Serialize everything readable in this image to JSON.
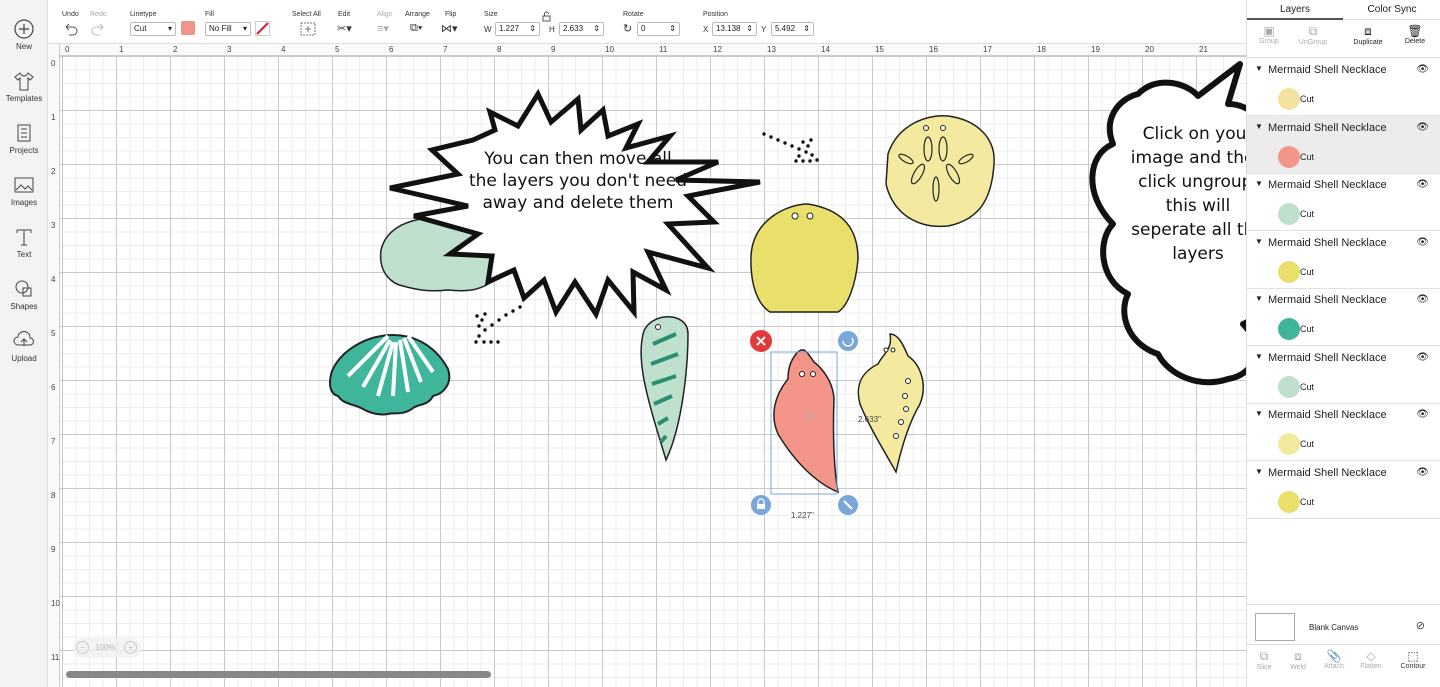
{
  "sidebar": {
    "items": [
      {
        "label": "New",
        "icon": "plus-circle-icon"
      },
      {
        "label": "Templates",
        "icon": "shirt-icon"
      },
      {
        "label": "Projects",
        "icon": "projects-icon"
      },
      {
        "label": "Images",
        "icon": "image-icon"
      },
      {
        "label": "Text",
        "icon": "text-icon"
      },
      {
        "label": "Shapes",
        "icon": "shapes-icon"
      },
      {
        "label": "Upload",
        "icon": "upload-icon"
      }
    ]
  },
  "toolbar": {
    "undo": "Undo",
    "redo": "Redo",
    "linetype_label": "Linetype",
    "linetype_value": "Cut",
    "fill_label": "Fill",
    "fill_value": "No Fill",
    "select_all": "Select All",
    "edit": "Edit",
    "align": "Align",
    "arrange": "Arrange",
    "flip": "Flip",
    "size_label": "Size",
    "w_label": "W",
    "w_value": "1.227",
    "h_label": "H",
    "h_value": "2.633",
    "rotate_label": "Rotate",
    "rotate_value": "0",
    "position_label": "Position",
    "x_label": "X",
    "x_value": "13.138",
    "y_label": "Y",
    "y_value": "5.492",
    "swatch_color": "#f49589"
  },
  "rulers": {
    "top": [
      "0",
      "1",
      "2",
      "3",
      "4",
      "5",
      "6",
      "7",
      "8",
      "9",
      "10",
      "11",
      "12",
      "13",
      "14",
      "15",
      "16",
      "17",
      "18",
      "19",
      "20",
      "21"
    ],
    "left": [
      "0",
      "1",
      "2",
      "3",
      "4",
      "5",
      "6",
      "7",
      "8",
      "9",
      "10",
      "11"
    ]
  },
  "canvas": {
    "bubble_left": "You can then move all the layers you don't need away and delete them",
    "bubble_right": "Click on your image and then click ungroup, this will seperate all the layers",
    "dim_height": "2.633\"",
    "dim_width": "1.227\"",
    "zoom": "100%"
  },
  "panel": {
    "tab_layers": "Layers",
    "tab_color_sync": "Color Sync",
    "btn_group": "Group",
    "btn_ungroup": "UnGroup",
    "btn_duplicate": "Duplicate",
    "btn_delete": "Delete",
    "layers": [
      {
        "name": "Mermaid Shell Necklace",
        "cut": "Cut",
        "color": "#f3e3a0"
      },
      {
        "name": "Mermaid Shell Necklace",
        "cut": "Cut",
        "color": "#f49589"
      },
      {
        "name": "Mermaid Shell Necklace",
        "cut": "Cut",
        "color": "#bfe0cc"
      },
      {
        "name": "Mermaid Shell Necklace",
        "cut": "Cut",
        "color": "#e8e06a"
      },
      {
        "name": "Mermaid Shell Necklace",
        "cut": "Cut",
        "color": "#3fb59c"
      },
      {
        "name": "Mermaid Shell Necklace",
        "cut": "Cut",
        "color": "#bfe0cc"
      },
      {
        "name": "Mermaid Shell Necklace",
        "cut": "Cut",
        "color": "#f3eaa0"
      },
      {
        "name": "Mermaid Shell Necklace",
        "cut": "Cut",
        "color": "#e8e06a"
      }
    ],
    "blank_canvas": "Blank Canvas",
    "bottom": {
      "slice": "Slice",
      "weld": "Weld",
      "attach": "Attach",
      "flatten": "Flatten",
      "contour": "Contour"
    }
  }
}
